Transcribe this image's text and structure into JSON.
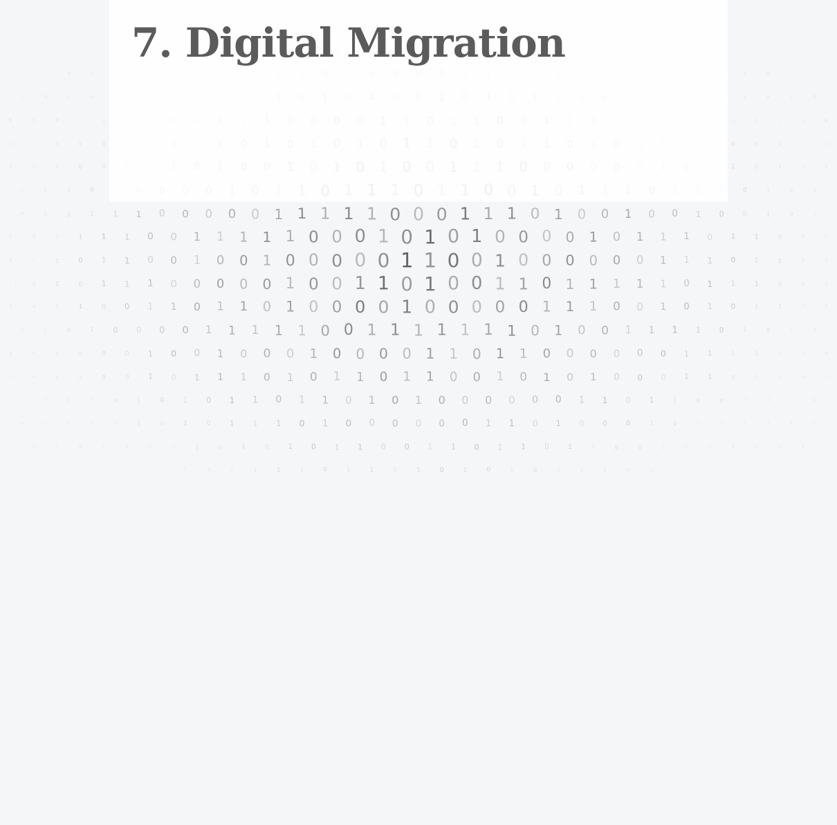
{
  "heading": {
    "title": "7. Digital Migration"
  },
  "visual": {
    "binary_rows": [
      "0001000010000",
      "1101001000101001000111",
      "0110110011001000101101011010010",
      "111000010011010101001010110111000101010",
      "0110100001010011100001101100111101010111001110",
      "0010010011000100110101010110101101010100011110101000",
      "001110001110000010100101010011100000010110110100110001",
      "0011110001111000000101101110110010111011001011101010101",
      "1100111001001111000001111100011101001001001011001111000",
      "00011011100011110011111000101010000101110110000100011111",
      "00011001011110110010010000011001000000111011001100010000",
      "10000010011010111000001001101001101111101110001000111000",
      "00111110100011001101101000010000011100101011000100011110",
      "1010101100010100001111100111111101001111010011011111000",
      "110111101101000100100010000110110000001111110101110110",
      "101101101000101110101101100101010001101101011101",
      "110001010010101101101010000001101100011101001",
      "1011001010111010000001101000101111101",
      "1101011101010110011011010011111011",
      "000111011010101011101"
    ],
    "digit_color": "#5a5a5a",
    "panel_color": "#ffffff",
    "background_color": "#f5f6f8"
  }
}
